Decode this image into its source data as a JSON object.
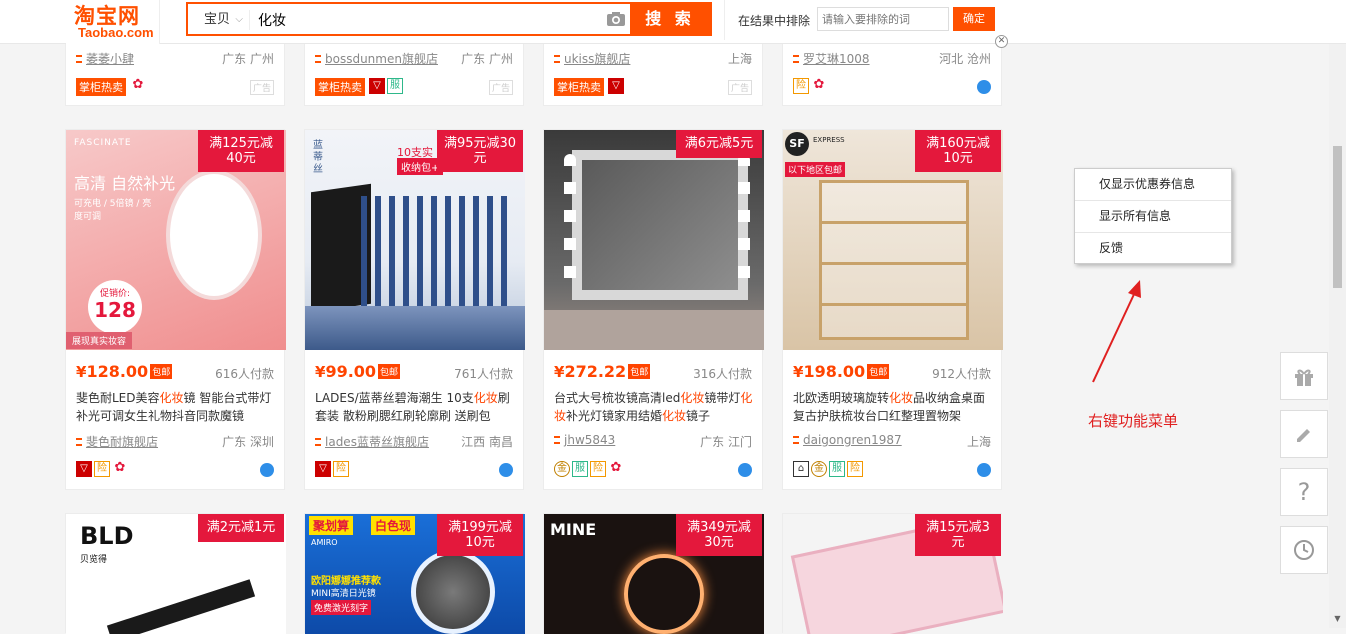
{
  "header": {
    "logo_cn": "淘宝网",
    "logo_en": "Taobao.com",
    "category": "宝贝",
    "query": "化妆",
    "search_label": "搜 索",
    "exclude_label": "在结果中排除",
    "exclude_placeholder": "请输入要排除的词",
    "exclude_button": "确定"
  },
  "top_row": [
    {
      "shop": "萎萎小肆",
      "location": "广东 广州",
      "hot": "掌柜热卖",
      "ad": "广告"
    },
    {
      "shop": "bossdunmen旗舰店",
      "location": "广东 广州",
      "hot": "掌柜热卖",
      "ad": "广告"
    },
    {
      "shop": "ukiss旗舰店",
      "location": "上海",
      "hot": "掌柜热卖",
      "ad": "广告"
    },
    {
      "shop": "罗艾琳1008",
      "location": "河北 沧州"
    }
  ],
  "products": [
    {
      "promo1": "满125元减",
      "promo2": "40元",
      "price": "128.00",
      "tag": "包邮",
      "sold": "616人付款",
      "title": "斐色耐LED美容化妆镜 智能台式带灯补光可调女生礼物抖音同款魔镜",
      "shop": "斐色耐旗舰店",
      "location": "广东 深圳",
      "img_text1": "FASCINATE",
      "img_text2": "高清 自然补光",
      "img_text3": "可充电 / 5倍镜 / 亮度可调",
      "img_text4": "促销价:",
      "img_text5": "128",
      "img_text6": "展现真实妆容"
    },
    {
      "promo1": "满95元减30",
      "promo2": "元",
      "price": "99.00",
      "tag": "包邮",
      "sold": "761人付款",
      "title": "LADES/蓝蒂丝碧海潮生 10支化妆刷套装 散粉刷腮红刷轮廓刷 送刷包",
      "shop": "lades蓝蒂丝旗舰店",
      "location": "江西 南昌",
      "img_text1": "10支实",
      "img_text2": "收纳包+",
      "img_text3": "蓝蒂丝"
    },
    {
      "promo1": "满6元减5元",
      "promo2": "",
      "price": "272.22",
      "tag": "包邮",
      "sold": "316人付款",
      "title": "台式大号梳妆镜高清led化妆镜带灯化妆补光灯镜家用结婚化妆镜子",
      "shop": "jhw5843",
      "location": "广东 江门"
    },
    {
      "promo1": "满160元减",
      "promo2": "10元",
      "price": "198.00",
      "tag": "包邮",
      "sold": "912人付款",
      "title": "北欧透明玻璃旋转化妆品收纳盒桌面复古护肤梳妆台口红整理置物架",
      "shop": "daigongren1987",
      "location": "上海",
      "img_text1": "EXPRESS",
      "img_text2": "以下地区包邮"
    }
  ],
  "bottom_row": [
    {
      "promo1": "满2元减1元",
      "promo2": "",
      "brand": "BLD",
      "brand_sub": "贝览得"
    },
    {
      "promo1": "满199元减",
      "promo2": "10元",
      "brand": "聚划算",
      "brand_sub": "白色现",
      "img_text1": "AMIRO",
      "img_text2": "欧阳娜娜推荐款",
      "img_text3": "MINI高清日光镜",
      "img_text4": "免费激光刻字"
    },
    {
      "promo1": "满349元减",
      "promo2": "30元",
      "brand": "MINE"
    },
    {
      "promo1": "满15元减3",
      "promo2": "元"
    }
  ],
  "context_menu": {
    "items": [
      "仅显示优惠券信息",
      "显示所有信息",
      "反馈"
    ]
  },
  "annotation": "右键功能菜单",
  "sidebar_help": "?",
  "colors": {
    "brand": "#ff5000",
    "promo": "#e4183c",
    "price": "#ff4400",
    "annotation": "#e02020"
  }
}
